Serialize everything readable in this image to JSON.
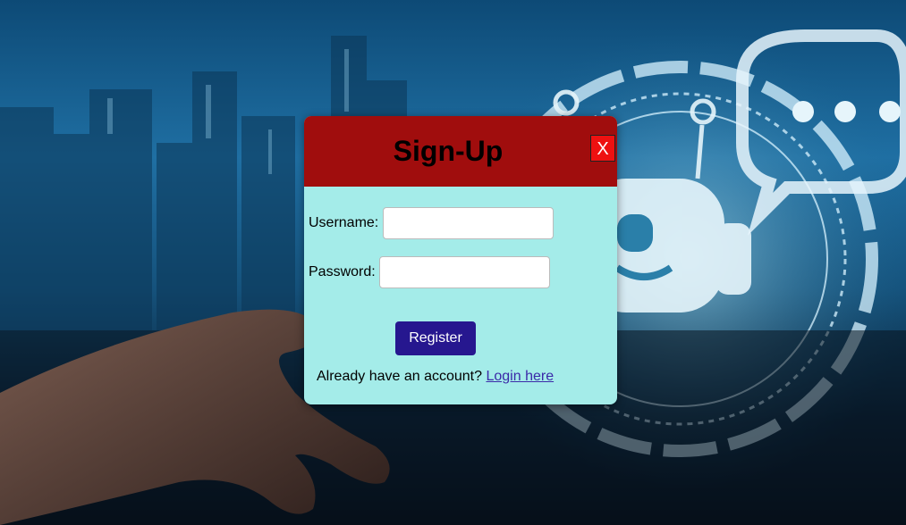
{
  "modal": {
    "title": "Sign-Up",
    "close_label": "X",
    "username_label": "Username:",
    "username_value": "",
    "password_label": "Password:",
    "password_value": "",
    "register_label": "Register",
    "footer_text": "Already have an account?",
    "login_link_label": "Login here"
  },
  "colors": {
    "header": "#a00d0d",
    "body": "#a4ece9",
    "close_button": "#ee1111",
    "register_button": "#26178f",
    "link": "#3b2aa8"
  }
}
